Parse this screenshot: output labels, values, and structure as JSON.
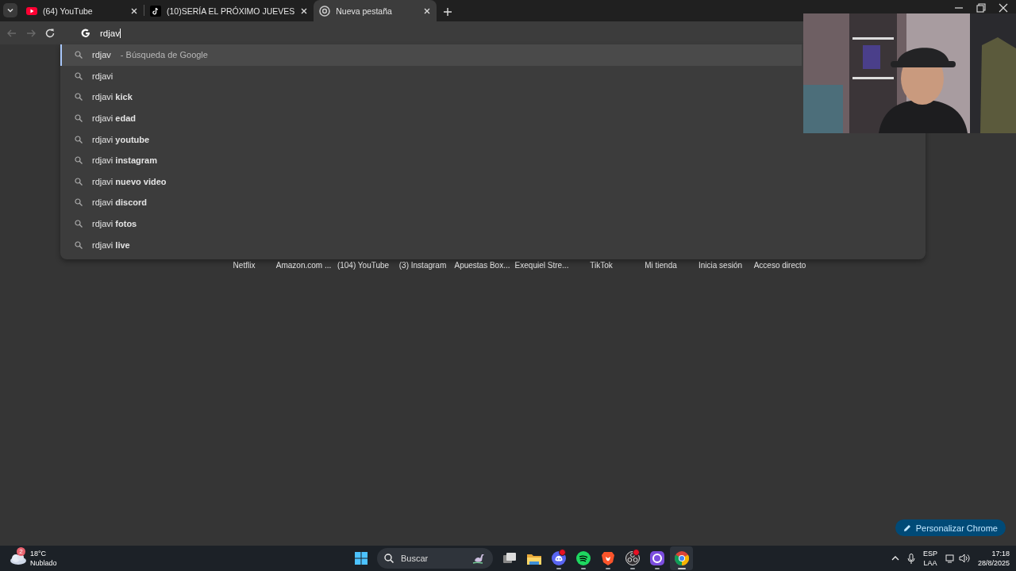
{
  "tabs": [
    {
      "title": "(64) YouTube",
      "kind": "youtube",
      "selected": false
    },
    {
      "title": "(10)SERÍA EL PRÓXIMO JUEVES",
      "kind": "tiktok",
      "selected": false
    },
    {
      "title": "Nueva pestaña",
      "kind": "chrome",
      "selected": true
    }
  ],
  "toolbar": {
    "back_disabled": true,
    "forward_disabled": true,
    "omnibox_value": "rdjav"
  },
  "suggestions": [
    {
      "text": "rdjav",
      "suffix": "- Búsqueda de Google",
      "selected": true
    },
    {
      "text": "rdjavi",
      "selected": false
    },
    {
      "text": "rdjavi **kick**",
      "selected": false
    },
    {
      "text": "rdjavi **edad**",
      "selected": false
    },
    {
      "text": "rdjavi **youtube**",
      "selected": false
    },
    {
      "text": "rdjavi **instagram**",
      "selected": false
    },
    {
      "text": "rdjavi **nuevo video**",
      "selected": false
    },
    {
      "text": "rdjavi **discord**",
      "selected": false
    },
    {
      "text": "rdjavi **fotos**",
      "selected": false
    },
    {
      "text": "rdjavi **live**",
      "selected": false
    }
  ],
  "shortcuts": [
    "Netflix",
    "Amazon.com ...",
    "(104) YouTube",
    "(3) Instagram",
    "Apuestas Box...",
    "Exequiel Stre...",
    "TikTok",
    "Mi tienda",
    "Inicia sesión",
    "Acceso directo"
  ],
  "customize_button": "Personalizar Chrome",
  "taskbar": {
    "weather": {
      "badge": "2",
      "temperature": "18°C",
      "condition": "Nublado"
    },
    "search_placeholder": "Buscar",
    "apps": [
      {
        "kind": "taskview",
        "running": false,
        "notification": false,
        "selected": false
      },
      {
        "kind": "folder",
        "running": false,
        "notification": false,
        "selected": false
      },
      {
        "kind": "discord",
        "running": true,
        "notification": true,
        "selected": false
      },
      {
        "kind": "spotify",
        "running": true,
        "notification": false,
        "selected": false
      },
      {
        "kind": "brave",
        "running": true,
        "notification": false,
        "selected": false
      },
      {
        "kind": "obs",
        "running": true,
        "notification": true,
        "selected": false
      },
      {
        "kind": "ring",
        "running": true,
        "notification": false,
        "selected": false
      },
      {
        "kind": "chrome",
        "running": true,
        "notification": false,
        "selected": true
      }
    ],
    "language": "ESP",
    "layout": "LAA",
    "time": "17:18",
    "date": "28/8/2025"
  }
}
